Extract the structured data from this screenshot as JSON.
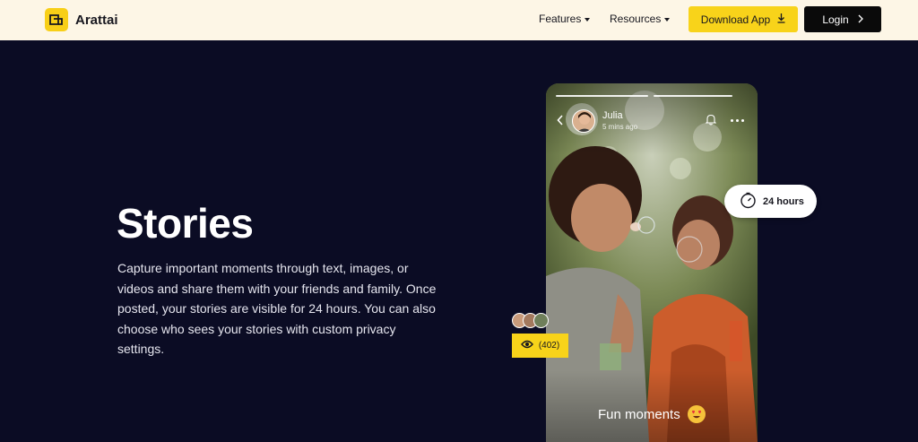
{
  "header": {
    "logo_text": "Arattai",
    "nav": [
      {
        "label": "Features"
      },
      {
        "label": "Resources"
      }
    ],
    "download_label": "Download App",
    "login_label": "Login"
  },
  "hero": {
    "title": "Stories",
    "description": "Capture important moments through text, images, or videos and share them with your friends and family. Once posted, your stories are visible for 24 hours. You can also choose who sees your stories with custom privacy settings."
  },
  "story": {
    "user_name": "Julia",
    "time_ago": "5 mins ago",
    "caption": "Fun moments"
  },
  "badges": {
    "duration": "24 hours",
    "views": "(402)"
  },
  "colors": {
    "accent": "#f8d31a",
    "background": "#0b0c24",
    "header_bg": "#fdf6e6"
  }
}
